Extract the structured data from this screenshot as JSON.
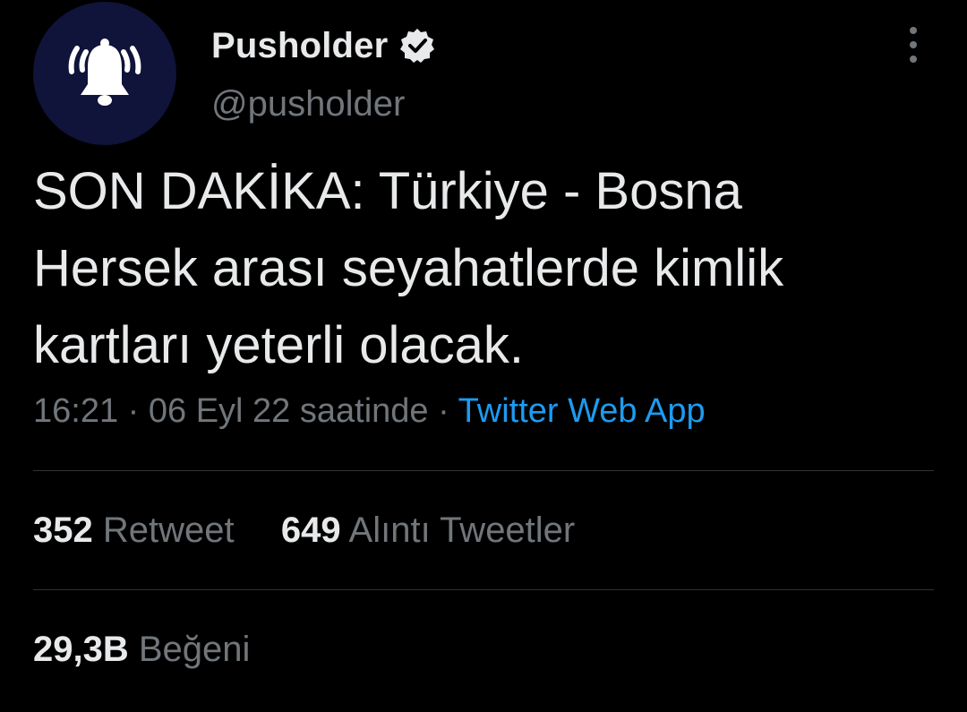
{
  "account": {
    "display_name": "Pusholder",
    "handle": "@pusholder",
    "avatar_icon": "bell-icon",
    "verified_icon": "verified-badge-icon"
  },
  "tweet": {
    "line1": "SON DAKİKA: Türkiye - Bosna",
    "line2": "Hersek arası seyahatlerde kimlik",
    "line3": "kartları yeterli olacak."
  },
  "meta": {
    "time": "16:21",
    "sep1": " · ",
    "date": "06 Eyl 22 saatinde",
    "sep2": " · ",
    "source": "Twitter Web App"
  },
  "stats": {
    "retweet_count": "352",
    "retweet_label": "Retweet",
    "quote_count": "649",
    "quote_label": "Alıntı Tweetler",
    "like_count": "29,3B",
    "like_label": "Beğeni"
  },
  "colors": {
    "background": "#000000",
    "text": "#e7e9ea",
    "muted": "#71767b",
    "link": "#1d9bf0",
    "divider": "#2f3336",
    "avatar_bg": "#10133a"
  }
}
